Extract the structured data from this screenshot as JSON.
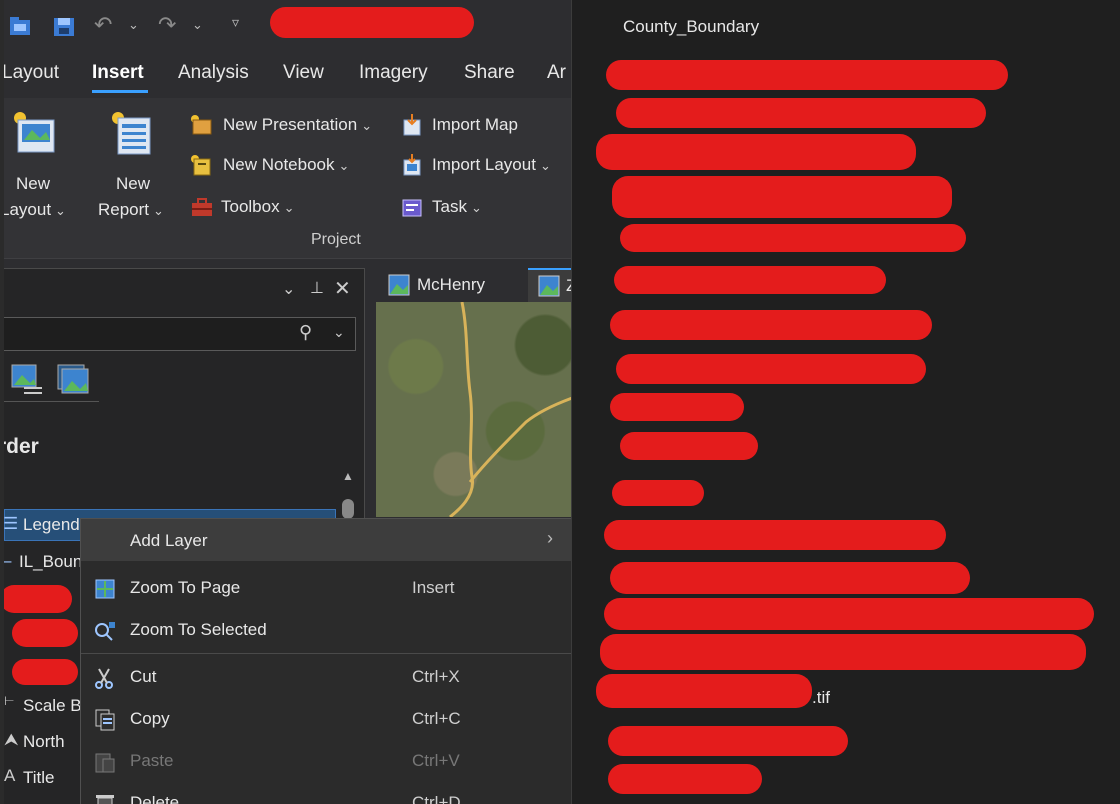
{
  "ribbon_tabs": [
    {
      "label": "Layout"
    },
    {
      "label": "Insert"
    },
    {
      "label": "Analysis"
    },
    {
      "label": "View"
    },
    {
      "label": "Imagery"
    },
    {
      "label": "Share"
    },
    {
      "label": "Ar"
    }
  ],
  "ribbon": {
    "new_layout": {
      "line1": "New",
      "line2": "Layout"
    },
    "new_report": {
      "line1": "New",
      "line2": "Report"
    },
    "new_presentation": "New Presentation",
    "new_notebook": "New Notebook",
    "toolbox": "Toolbox",
    "import_map": "Import Map",
    "import_layout": "Import Layout",
    "task": "Task",
    "group_label": "Project"
  },
  "contents_pane": {
    "section_title": "rder",
    "items": [
      {
        "label": "Legend"
      },
      {
        "label": "IL_Boun"
      },
      {
        "label": "Scale B"
      },
      {
        "label": "North"
      },
      {
        "label": "Title"
      }
    ]
  },
  "map_tabs": [
    {
      "label": "McHenry"
    },
    {
      "label": "Z"
    }
  ],
  "context_menu": {
    "add_layer": "Add Layer",
    "items": [
      {
        "label": "Zoom To Page",
        "shortcut": "Insert",
        "icon": "zoom-to-page-icon"
      },
      {
        "label": "Zoom To Selected",
        "shortcut": "",
        "icon": "zoom-to-selected-icon"
      },
      {
        "label": "Cut",
        "shortcut": "Ctrl+X",
        "icon": "scissors-icon"
      },
      {
        "label": "Copy",
        "shortcut": "Ctrl+C",
        "icon": "copy-icon"
      },
      {
        "label": "Paste",
        "shortcut": "Ctrl+V",
        "icon": "paste-icon",
        "disabled": true
      },
      {
        "label": "Delete",
        "shortcut": "Ctrl+D",
        "icon": "delete-icon"
      }
    ]
  },
  "right_panel": {
    "first_item": "County_Boundary",
    "tif_suffix": ".tif"
  },
  "colors": {
    "accent": "#3aa0ff",
    "redaction": "#e41c1c"
  }
}
